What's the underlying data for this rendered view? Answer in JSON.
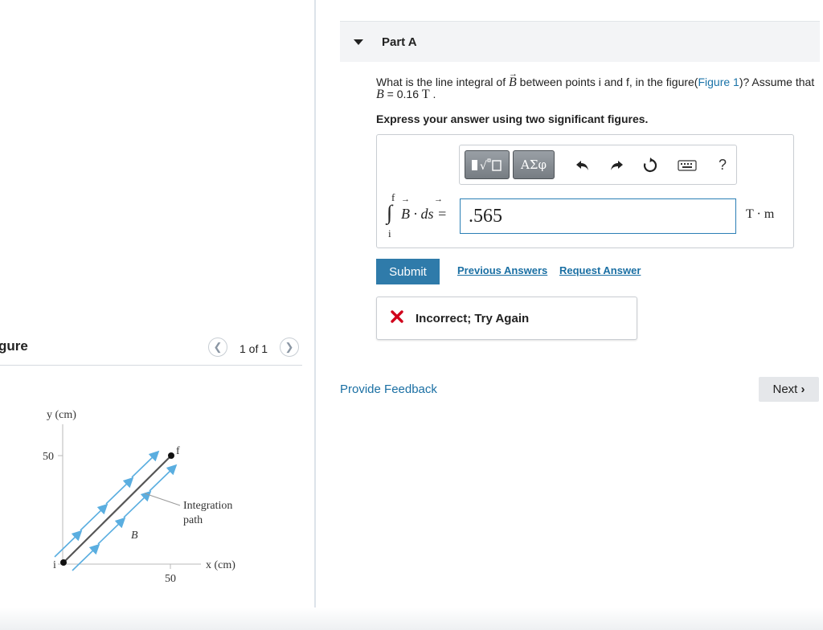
{
  "figure_panel": {
    "title": "gure",
    "pager": "1 of 1",
    "figure": {
      "y_axis_label": "y (cm)",
      "x_axis_label": "x (cm)",
      "y_tick": "50",
      "x_tick": "50",
      "point_i": "i",
      "point_f": "f",
      "field_label": "B",
      "path_label_line1": "Integration",
      "path_label_line2": "path",
      "arrow_color": "#5aaee0"
    }
  },
  "part": {
    "title": "Part A",
    "question_prefix": "What is the line integral of ",
    "question_vector": "B",
    "question_middle": " between points i and f, in the figure(",
    "question_link": "Figure 1",
    "question_suffix": ")? Assume that ",
    "question_var": "B",
    "question_value": " = 0.16 ",
    "question_unit": "T",
    "question_end": " .",
    "instruction": "Express your answer using two significant figures."
  },
  "toolbar": {
    "templates_icon": "templates-icon",
    "greek_label": "ΑΣφ",
    "undo_icon": "undo-icon",
    "redo_icon": "redo-icon",
    "reset_icon": "reset-icon",
    "keyboard_icon": "keyboard-icon",
    "help_label": "?"
  },
  "answer": {
    "integral_upper": "f",
    "integral_lower": "i",
    "integrand": "B · ds =",
    "value": ".565",
    "unit": "T · m"
  },
  "actions": {
    "submit_label": "Submit",
    "previous_answers": "Previous Answers",
    "request_answer": "Request Answer"
  },
  "feedback": {
    "status": "Incorrect; Try Again",
    "status_color": "#d0021b"
  },
  "footer": {
    "provide_feedback": "Provide Feedback",
    "next_label": "Next"
  }
}
